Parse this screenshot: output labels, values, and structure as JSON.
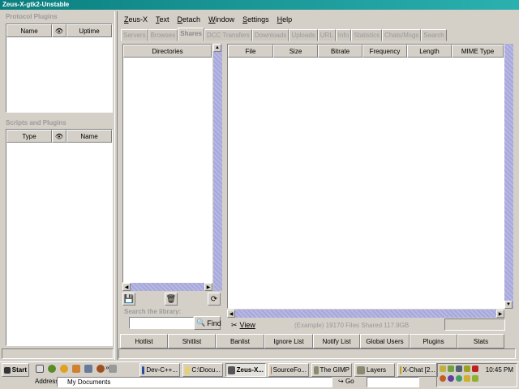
{
  "window": {
    "title": "Zeus-X-gtk2-Unstable"
  },
  "left": {
    "protocol_title": "Protocol Plugins",
    "protocol_cols": [
      "Name",
      "Uptime"
    ],
    "scripts_title": "Scripts and Plugins",
    "scripts_cols": [
      "Type",
      "Name"
    ]
  },
  "menu": [
    "Zeus-X",
    "Text",
    "Detach",
    "Window",
    "Settings",
    "Help"
  ],
  "tabs": [
    "Servers",
    "Browses",
    "Shares",
    "DCC Transfers",
    "Downloads",
    "Uploads",
    "URL",
    "Info",
    "Statistics",
    "Chats/Msgs",
    "Search"
  ],
  "active_tab": "Shares",
  "shares": {
    "dir_header": "Directories",
    "file_cols": [
      "File",
      "Size",
      "Bitrate",
      "Frequency",
      "Length",
      "MIME Type"
    ],
    "search_label": "Search the library:",
    "search_value": "",
    "find_label": "Find",
    "view_label": "View",
    "status": "(Example) 19170 Files Shared 117.9GB"
  },
  "bottom_buttons": [
    "Hotlist",
    "Shitlist",
    "Banlist",
    "Ignore List",
    "Notify List",
    "Global Users",
    "Plugins",
    "Stats"
  ],
  "taskbar": {
    "start": "Start",
    "tasks": [
      "Dev-C++...",
      "C:\\Docu...",
      "Zeus-X...",
      "SourceFo...",
      "The GIMP",
      "Layers",
      "X-Chat [2..."
    ],
    "active_task": "Zeus-X...",
    "address_label": "Address",
    "address_value": "My Documents",
    "go": "Go",
    "clock": "10:45 PM"
  }
}
